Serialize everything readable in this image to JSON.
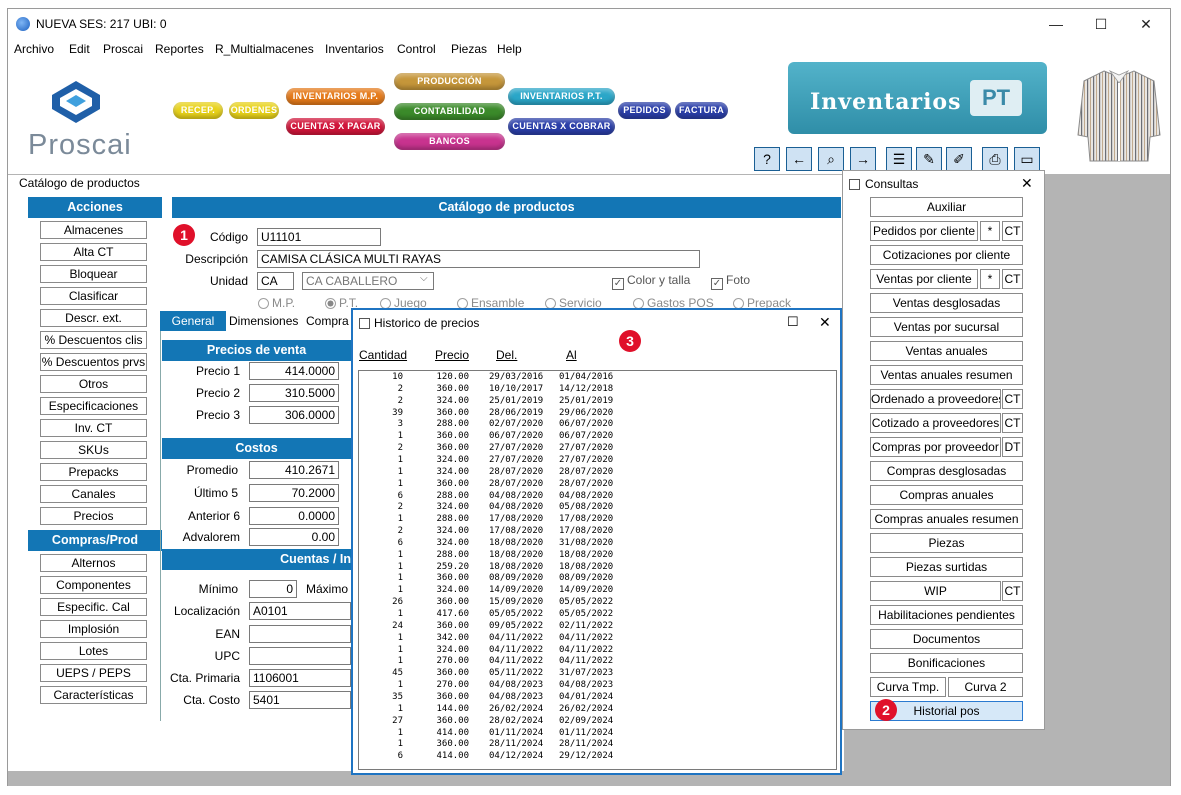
{
  "window": {
    "title": "NUEVA  SES: 217  UBI: 0",
    "minimize": "—",
    "maximize": "☐",
    "close": "✕"
  },
  "menu": [
    "Archivo",
    "Edit",
    "Proscai",
    "Reportes",
    "R_Multialmacenes",
    "Inventarios",
    "Control",
    "Piezas",
    "Help"
  ],
  "banner": {
    "logo_text": "Proscai",
    "modules": {
      "recep": "RECEP.",
      "ordenes": "ORDENES",
      "inventarios_mp": "INVENTARIOS M.P.",
      "cuentas_x_pagar": "CUENTAS X PAGAR",
      "produccion": "PRODUCCIÓN",
      "contabilidad": "CONTABILIDAD",
      "bancos": "BANCOS",
      "inventarios_pt": "INVENTARIOS P.T.",
      "cuentas_x_cobrar": "CUENTAS X COBRAR",
      "pedidos": "PEDIDOS",
      "factura": "FACTURA"
    },
    "inventarios_title": "Inventarios",
    "pt_label": "PT"
  },
  "toolbar": [
    "?",
    "←",
    "⌕",
    "→",
    "☰",
    "✎",
    "✐",
    "⎙",
    "▭"
  ],
  "catalogo": {
    "window_title": "Catálogo de productos",
    "header": "Catálogo de productos",
    "acciones_header": "Acciones",
    "acciones": [
      "Almacenes",
      "Alta CT",
      "Bloquear",
      "Clasificar",
      "Descr. ext.",
      "% Descuentos clis",
      "% Descuentos prvs",
      "Otros",
      "Especificaciones",
      "Inv. CT",
      "SKUs",
      "Prepacks",
      "Canales",
      "Precios"
    ],
    "compras_header": "Compras/Prod",
    "compras": [
      "Alternos",
      "Componentes",
      "Especific. Cal",
      "Implosión",
      "Lotes",
      "UEPS / PEPS",
      "Características"
    ],
    "codigo_label": "Código",
    "codigo": "U11101",
    "descripcion_label": "Descripción",
    "descripcion": "CAMISA CLÁSICA MULTI RAYAS",
    "unidad_label": "Unidad",
    "unidad": "CA",
    "unidad_desc": "CA  CABALLERO",
    "color_talla": "Color y talla",
    "foto": "Foto",
    "tipos": [
      "M.P.",
      "P.T.",
      "Juego",
      "Ensamble",
      "Servicio",
      "Gastos POS",
      "Prepack"
    ],
    "tabs": [
      "General",
      "Dimensiones",
      "Compra"
    ],
    "precios_header": "Precios de venta",
    "precio1_label": "Precio 1",
    "precio1": "414.0000",
    "precio2_label": "Precio 2",
    "precio2": "310.5000",
    "precio3_label": "Precio 3",
    "precio3": "306.0000",
    "costos_header": "Costos",
    "promedio_label": "Promedio",
    "promedio": "410.2671",
    "ultimo5_label": "Último 5",
    "ultimo5": "70.2000",
    "anterior6_label": "Anterior 6",
    "anterior6": "0.0000",
    "advalorem_label": "Advalorem",
    "advalorem": "0.00",
    "cuentas_header": "Cuentas / In",
    "minimo_label": "Mínimo",
    "minimo": "0",
    "maximo_label": "Máximo",
    "localizacion_label": "Localización",
    "localizacion": "A0101",
    "ean_label": "EAN",
    "upc_label": "UPC",
    "cta_primaria_label": "Cta. Primaria",
    "cta_primaria": "1106001",
    "cta_costo_label": "Cta. Costo",
    "cta_costo": "5401"
  },
  "badges": {
    "one": "1",
    "two": "2",
    "three": "3"
  },
  "consultas": {
    "title": "Consultas",
    "close": "✕",
    "auxiliar": "Auxiliar",
    "pedidos_cliente": "Pedidos por cliente",
    "cotizaciones_cliente": "Cotizaciones por cliente",
    "ventas_cliente": "Ventas por cliente",
    "ventas_desglosadas": "Ventas desglosadas",
    "ventas_sucursal": "Ventas por sucursal",
    "ventas_anuales": "Ventas anuales",
    "ventas_anuales_resumen": "Ventas anuales resumen",
    "ordenado_proveedores": "Ordenado a proveedores",
    "cotizado_proveedores": "Cotizado a proveedores",
    "compras_proveedor": "Compras por proveedor",
    "compras_desglosadas": "Compras desglosadas",
    "compras_anuales": "Compras anuales",
    "compras_anuales_resumen": "Compras anuales resumen",
    "piezas": "Piezas",
    "piezas_surtidas": "Piezas surtidas",
    "wip": "WIP",
    "habilitaciones": "Habilitaciones pendientes",
    "documentos": "Documentos",
    "bonificaciones": "Bonificaciones",
    "curva_tmp": "Curva Tmp.",
    "curva_2": "Curva 2",
    "historial_pos": "Historial pos",
    "star": "*",
    "ct": "CT",
    "dt": "DT"
  },
  "historico": {
    "title": "Historico de precios",
    "maximize": "☐",
    "close": "✕",
    "columns": [
      "Cantidad",
      "Precio",
      "Del.",
      "Al"
    ],
    "rows": [
      [
        "10",
        "120.00",
        "29/03/2016",
        "01/04/2016"
      ],
      [
        "2",
        "360.00",
        "10/10/2017",
        "14/12/2018"
      ],
      [
        "2",
        "324.00",
        "25/01/2019",
        "25/01/2019"
      ],
      [
        "39",
        "360.00",
        "28/06/2019",
        "29/06/2020"
      ],
      [
        "3",
        "288.00",
        "02/07/2020",
        "06/07/2020"
      ],
      [
        "1",
        "360.00",
        "06/07/2020",
        "06/07/2020"
      ],
      [
        "2",
        "360.00",
        "27/07/2020",
        "27/07/2020"
      ],
      [
        "1",
        "324.00",
        "27/07/2020",
        "27/07/2020"
      ],
      [
        "1",
        "324.00",
        "28/07/2020",
        "28/07/2020"
      ],
      [
        "1",
        "360.00",
        "28/07/2020",
        "28/07/2020"
      ],
      [
        "6",
        "288.00",
        "04/08/2020",
        "04/08/2020"
      ],
      [
        "2",
        "324.00",
        "04/08/2020",
        "05/08/2020"
      ],
      [
        "1",
        "288.00",
        "17/08/2020",
        "17/08/2020"
      ],
      [
        "2",
        "324.00",
        "17/08/2020",
        "17/08/2020"
      ],
      [
        "6",
        "324.00",
        "18/08/2020",
        "31/08/2020"
      ],
      [
        "1",
        "288.00",
        "18/08/2020",
        "18/08/2020"
      ],
      [
        "1",
        "259.20",
        "18/08/2020",
        "18/08/2020"
      ],
      [
        "1",
        "360.00",
        "08/09/2020",
        "08/09/2020"
      ],
      [
        "1",
        "324.00",
        "14/09/2020",
        "14/09/2020"
      ],
      [
        "26",
        "360.00",
        "15/09/2020",
        "05/05/2022"
      ],
      [
        "1",
        "417.60",
        "05/05/2022",
        "05/05/2022"
      ],
      [
        "24",
        "360.00",
        "09/05/2022",
        "02/11/2022"
      ],
      [
        "1",
        "342.00",
        "04/11/2022",
        "04/11/2022"
      ],
      [
        "1",
        "324.00",
        "04/11/2022",
        "04/11/2022"
      ],
      [
        "1",
        "270.00",
        "04/11/2022",
        "04/11/2022"
      ],
      [
        "45",
        "360.00",
        "05/11/2022",
        "31/07/2023"
      ],
      [
        "1",
        "270.00",
        "04/08/2023",
        "04/08/2023"
      ],
      [
        "35",
        "360.00",
        "04/08/2023",
        "04/01/2024"
      ],
      [
        "1",
        "144.00",
        "26/02/2024",
        "26/02/2024"
      ],
      [
        "27",
        "360.00",
        "28/02/2024",
        "02/09/2024"
      ],
      [
        "1",
        "414.00",
        "01/11/2024",
        "01/11/2024"
      ],
      [
        "1",
        "360.00",
        "28/11/2024",
        "28/11/2024"
      ],
      [
        "6",
        "414.00",
        "04/12/2024",
        "29/12/2024"
      ]
    ]
  }
}
